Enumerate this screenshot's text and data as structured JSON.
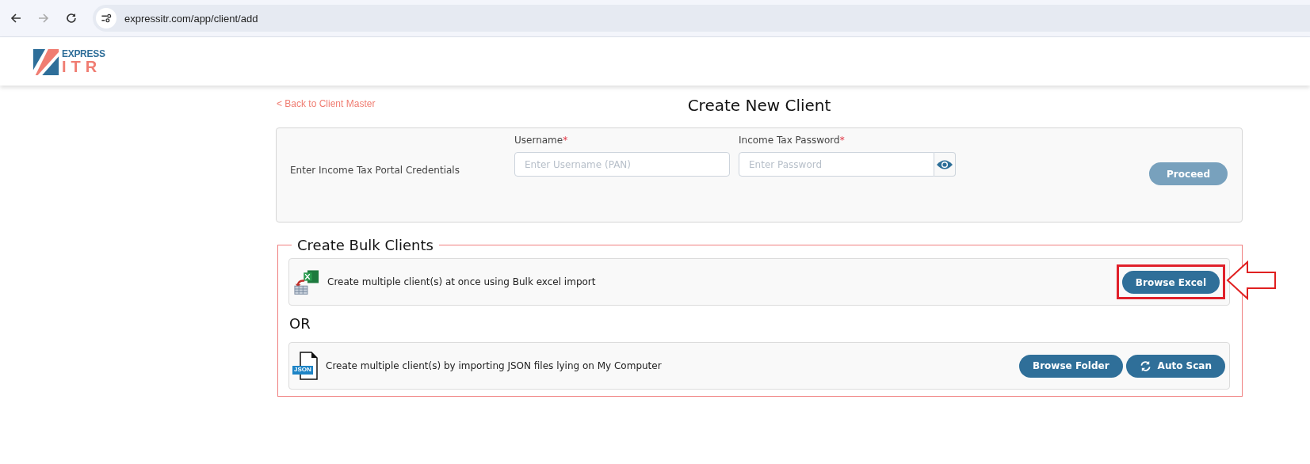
{
  "browser": {
    "url": "expressitr.com/app/client/add",
    "forward_disabled": true
  },
  "header": {
    "logo_top": "EXPRESS",
    "logo_bottom": "ITR"
  },
  "back_link": "< Back to Client Master",
  "title": "Create New Client",
  "credentials": {
    "label": "Enter Income Tax Portal Credentials",
    "fields": [
      {
        "kind": "text",
        "label": "Username",
        "required_mark": "*",
        "placeholder": "Enter Username (PAN)"
      },
      {
        "kind": "password",
        "label": "Income Tax Password",
        "required_mark": "*",
        "placeholder": "Enter Password"
      }
    ],
    "proceed": {
      "label": "Proceed",
      "disabled": true
    }
  },
  "bulk": {
    "legend": "Create Bulk Clients",
    "options": [
      {
        "kind": "excel",
        "text": "Create multiple client(s) at once using Bulk excel import",
        "buttons": [
          {
            "label": "Browse Excel",
            "highlighted": true
          }
        ]
      },
      {
        "kind": "separator",
        "text": "OR"
      },
      {
        "kind": "json",
        "icon_label": "JSON",
        "text": "Create multiple client(s) by importing JSON files lying on My Computer",
        "buttons": [
          {
            "label": "Browse Folder",
            "highlighted": false
          },
          {
            "kind": "scan",
            "label": "Auto Scan",
            "highlighted": false
          }
        ]
      }
    ]
  }
}
